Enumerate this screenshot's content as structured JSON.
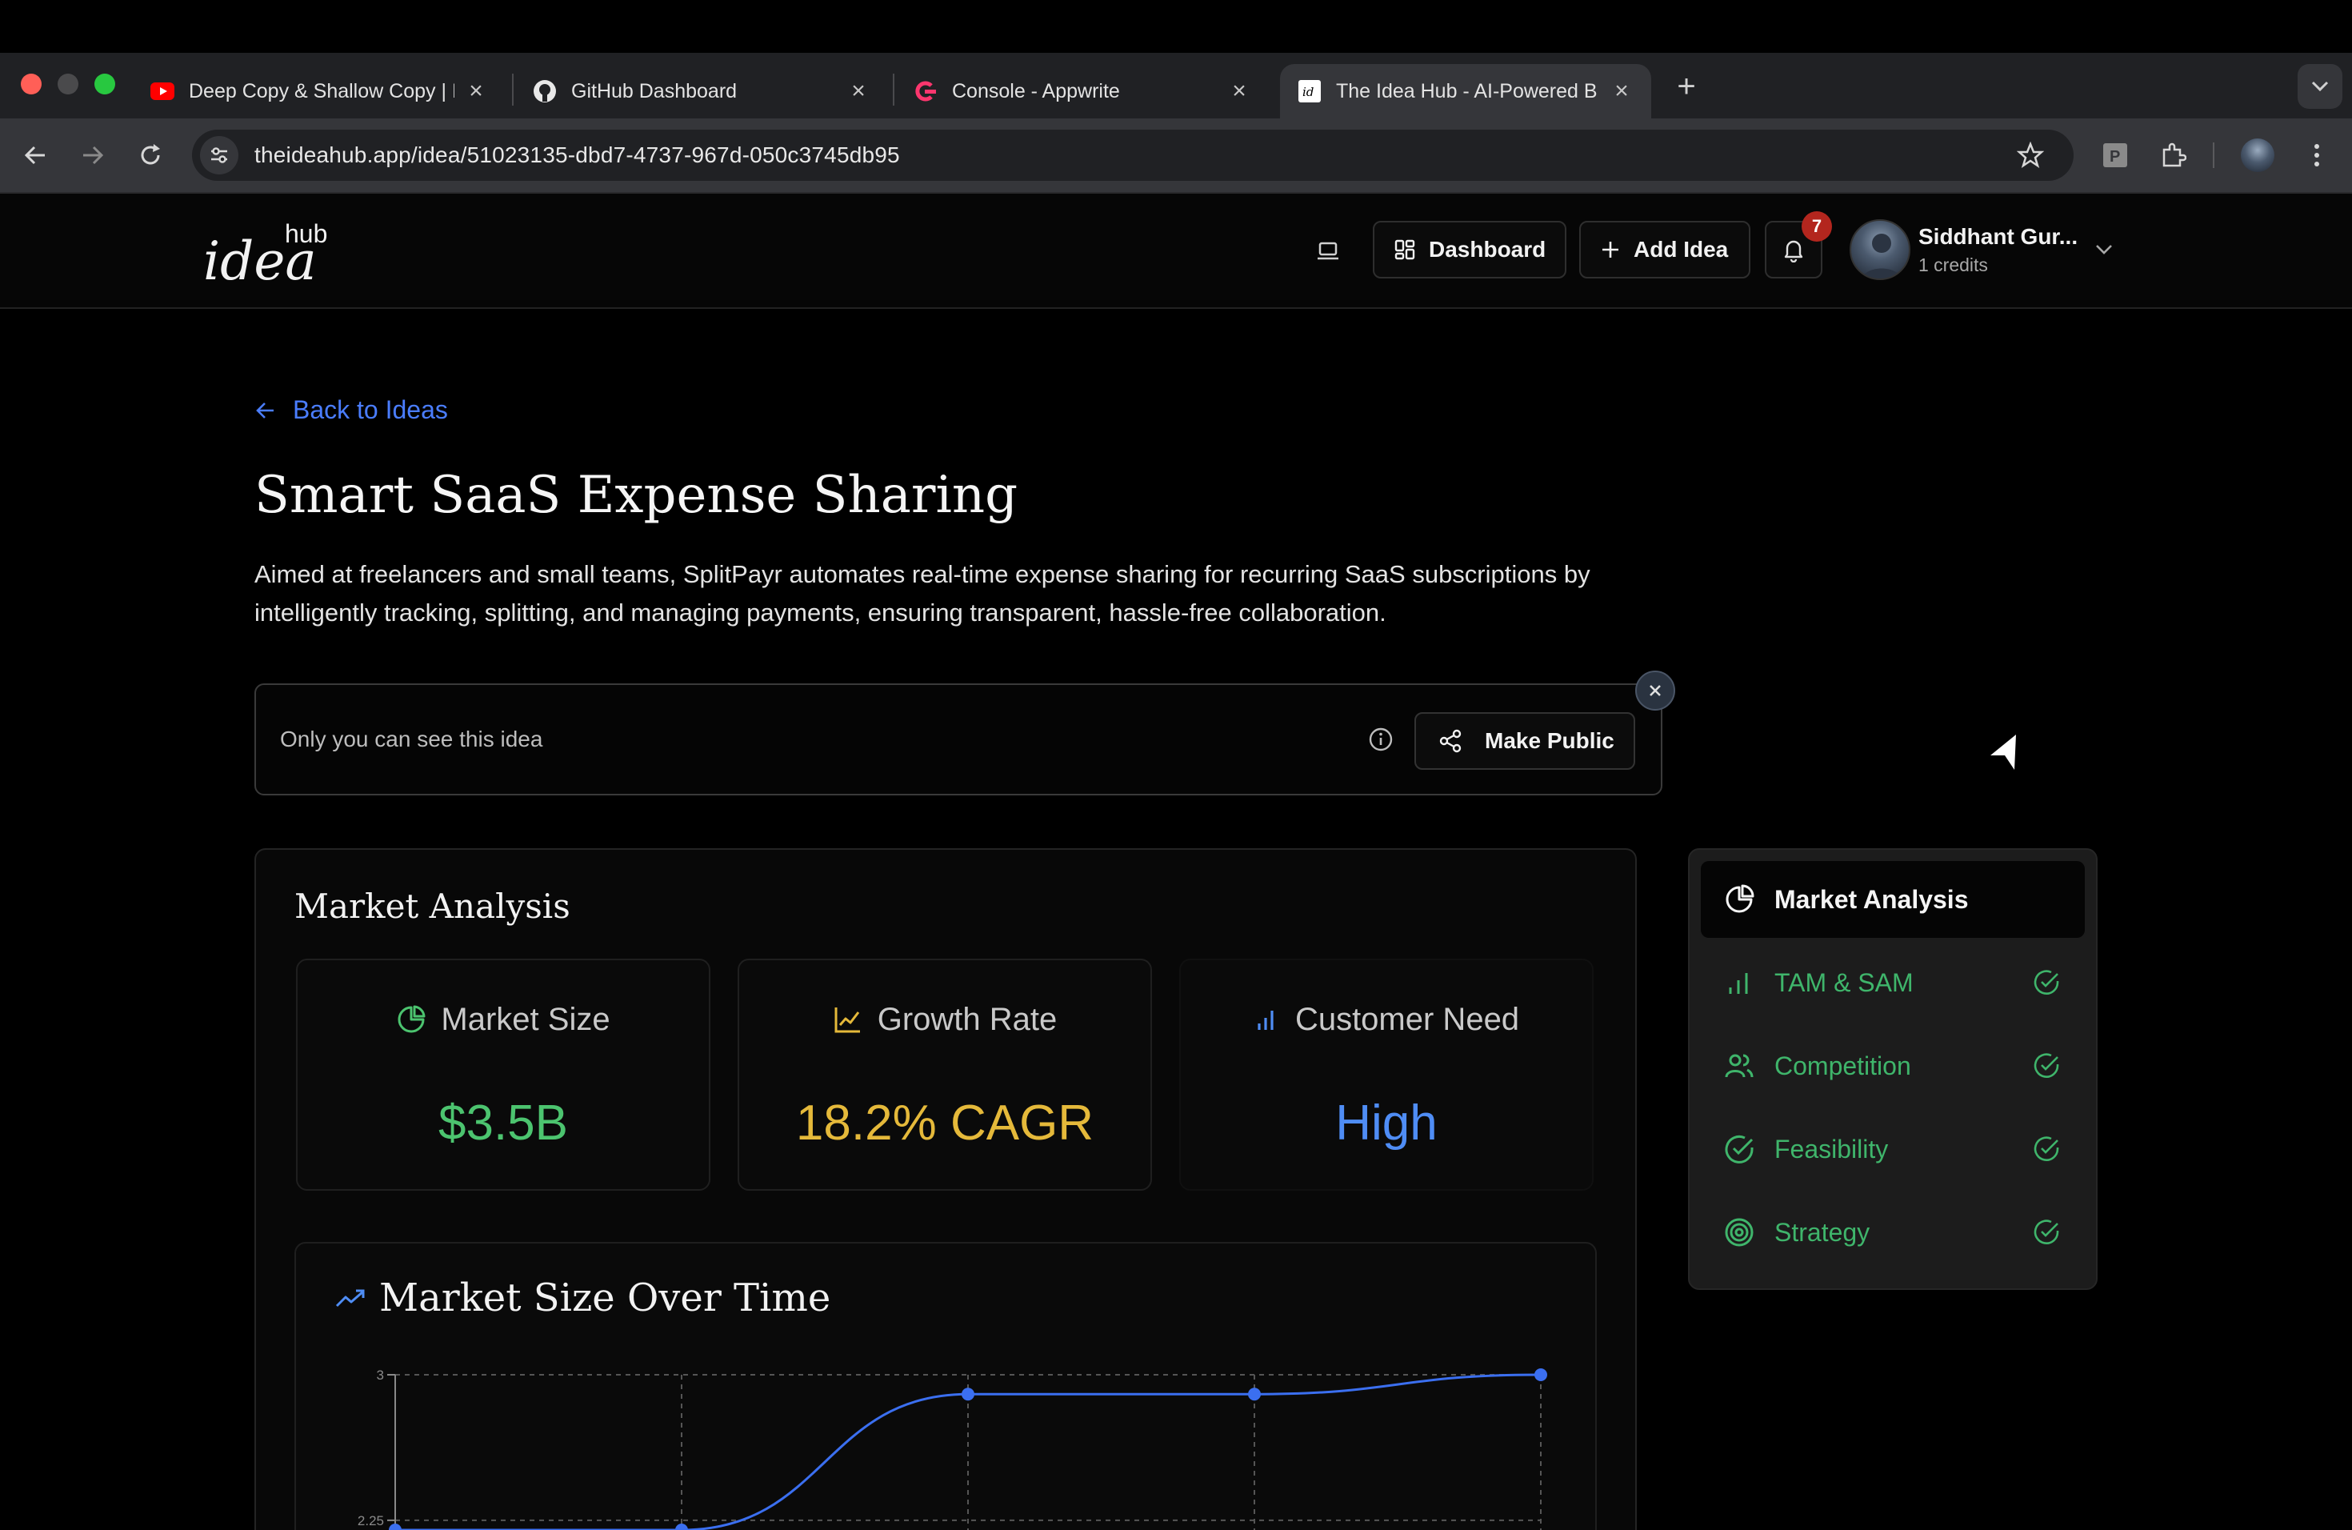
{
  "browser": {
    "tabs": [
      {
        "title": "Deep Copy & Shallow Copy | I",
        "icon": "youtube-icon"
      },
      {
        "title": "GitHub Dashboard",
        "icon": "github-icon"
      },
      {
        "title": "Console - Appwrite",
        "icon": "appwrite-icon"
      },
      {
        "title": "The Idea Hub - AI-Powered B",
        "icon": "ideahub-icon",
        "active": true
      }
    ],
    "url": "theideahub.app/idea/51023135-dbd7-4737-967d-050c3745db95"
  },
  "header": {
    "logo_main": "idea",
    "logo_sup": "hub",
    "dashboard_label": "Dashboard",
    "add_idea_label": "Add Idea",
    "notification_count": "7",
    "user_name": "Siddhant Gur...",
    "user_credits": "1 credits"
  },
  "page": {
    "back_label": "Back to Ideas",
    "title": "Smart SaaS Expense Sharing",
    "description": "Aimed at freelancers and small teams, SplitPayr automates real-time expense sharing for recurring SaaS subscriptions by intelligently tracking, splitting, and managing payments, ensuring transparent, hassle-free collaboration.",
    "privacy_text": "Only you can see this idea",
    "make_public_label": "Make Public"
  },
  "market_analysis": {
    "title": "Market Analysis",
    "stats": [
      {
        "label": "Market Size",
        "value": "$3.5B",
        "color": "#4cc46f",
        "icon": "pie-chart-icon"
      },
      {
        "label": "Growth Rate",
        "value": "18.2% CAGR",
        "color": "#e5b93a",
        "icon": "line-chart-icon"
      },
      {
        "label": "Customer Need",
        "value": "High",
        "color": "#4f8df5",
        "icon": "bar-chart-icon"
      }
    ],
    "chart_title": "Market Size Over Time"
  },
  "chart_data": {
    "type": "line",
    "title": "Market Size Over Time",
    "y_ticks": [
      "3",
      "2.25"
    ],
    "y_tick_values": [
      3,
      2.25
    ],
    "ylim_visible": [
      2.2,
      3
    ],
    "series": [
      {
        "values": [
          2.2,
          2.2,
          2.9,
          2.9,
          3.0
        ]
      }
    ],
    "color": "#3b6ff0",
    "grid": true
  },
  "sidenav": {
    "active": {
      "label": "Market Analysis",
      "icon": "pie-chart-icon"
    },
    "items": [
      {
        "label": "TAM & SAM",
        "icon": "bar-chart-icon"
      },
      {
        "label": "Competition",
        "icon": "users-icon"
      },
      {
        "label": "Feasibility",
        "icon": "check-circle-icon"
      },
      {
        "label": "Strategy",
        "icon": "target-icon"
      }
    ],
    "accent": "#3fb56b"
  }
}
